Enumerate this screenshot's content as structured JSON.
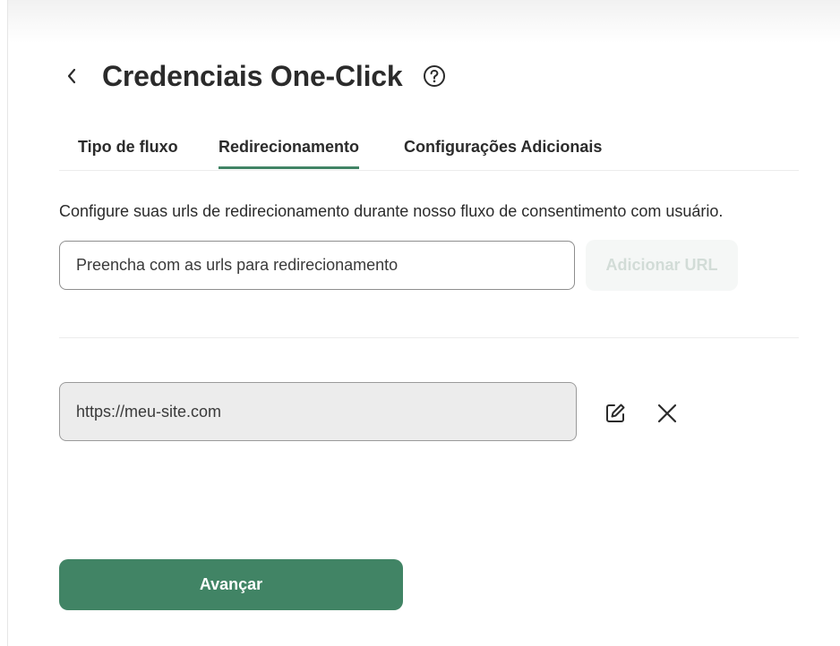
{
  "header": {
    "title": "Credenciais One-Click"
  },
  "tabs": [
    {
      "label": "Tipo de fluxo",
      "active": false
    },
    {
      "label": "Redirecionamento",
      "active": true
    },
    {
      "label": "Configurações Adicionais",
      "active": false
    }
  ],
  "redirect": {
    "description": "Configure suas urls de redirecionamento durante nosso fluxo de consentimento com usuário.",
    "input_placeholder": "Preencha com as urls para redirecionamento",
    "input_value": "",
    "add_button_label": "Adicionar URL",
    "add_button_enabled": false,
    "urls": [
      {
        "value": "https://meu-site.com"
      }
    ]
  },
  "footer": {
    "next_label": "Avançar"
  },
  "icons": {
    "back": "chevron-left-icon",
    "help": "help-circle-icon",
    "edit": "edit-icon",
    "remove": "close-icon"
  },
  "colors": {
    "accent": "#418465",
    "text": "#2b2b2b",
    "disabled_button_bg": "#f5f7f6",
    "disabled_button_text": "#d2dcd7",
    "url_field_bg": "#ececec"
  }
}
